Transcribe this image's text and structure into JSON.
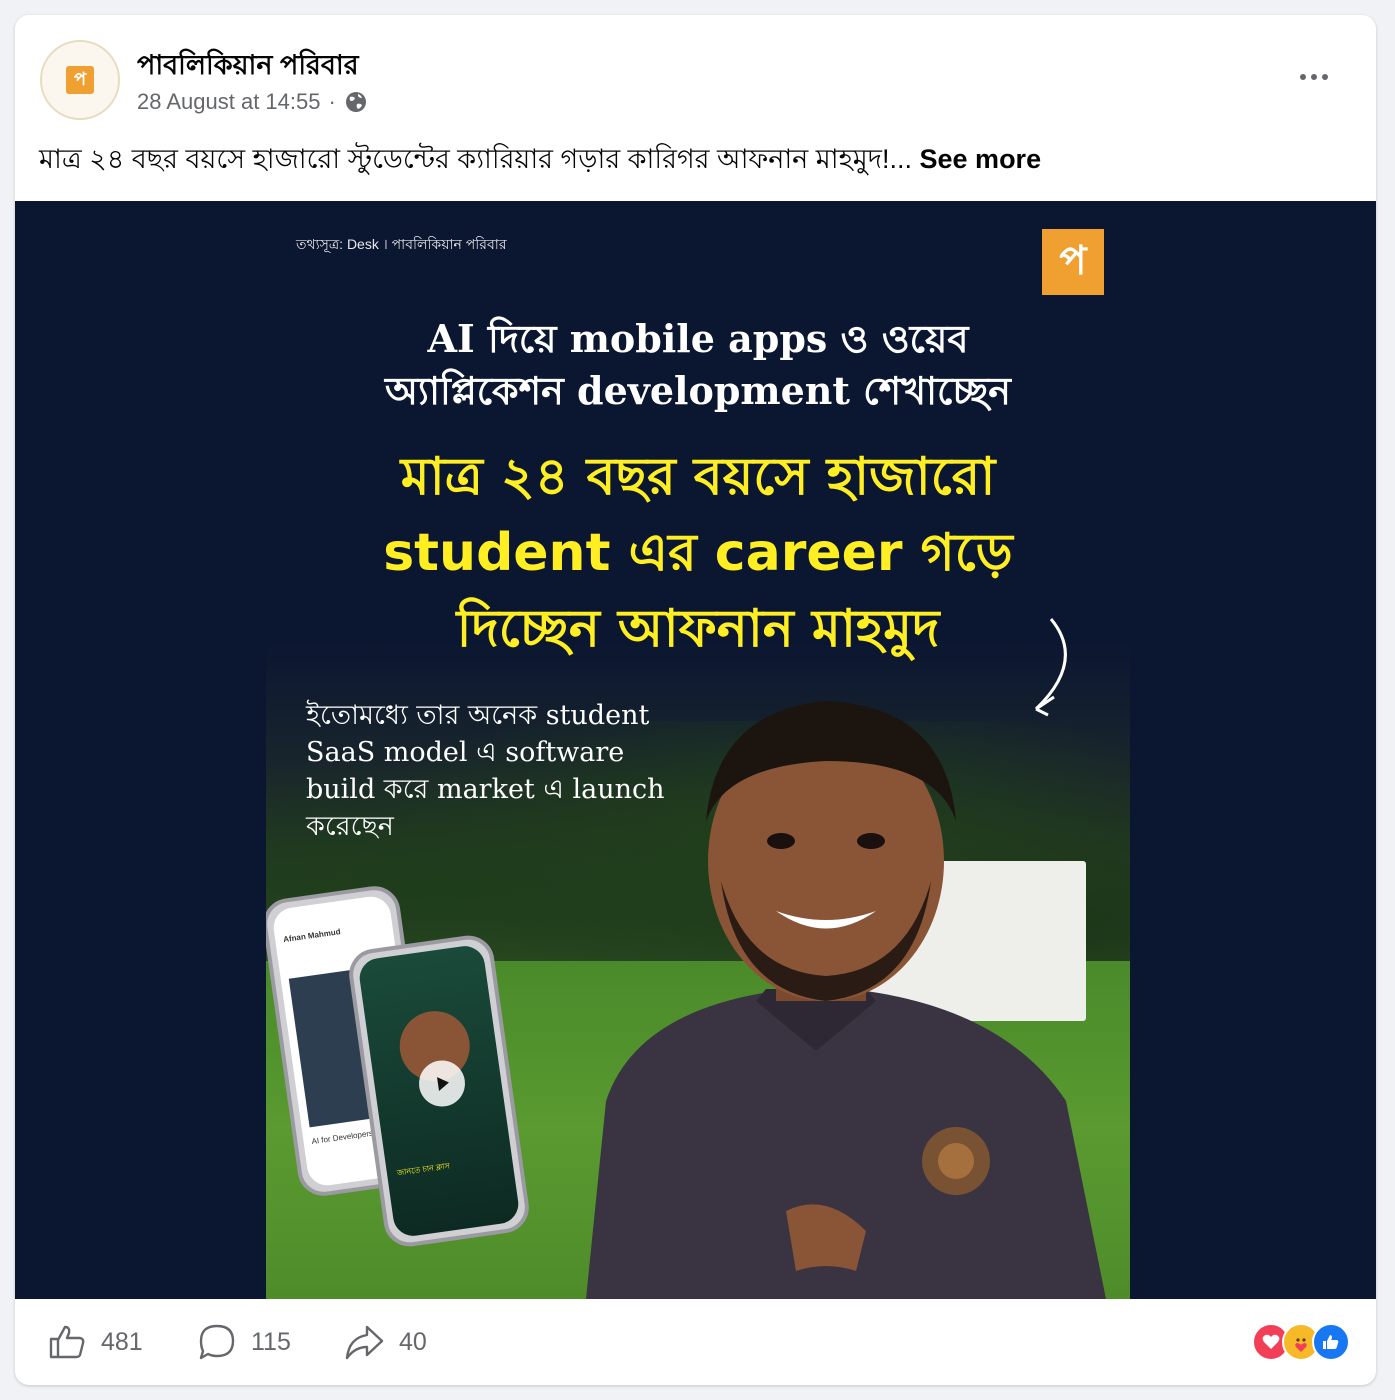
{
  "post": {
    "page_name": "পাবলিকিয়ান পরিবার",
    "timestamp": "28 August at 14:55",
    "separator": "·",
    "privacy_icon": "globe-icon",
    "caption": "মাত্র ২৪ বছর বয়সে হাজারো স্টুডেন্টের ক্যারিয়ার গড়ার কারিগর আফনান মাহমুদ!...",
    "see_more": "See more"
  },
  "image": {
    "source_text": "তথ্যসূত্র: Desk । পাবলিকিয়ান পরিবার",
    "headline_1": [
      "AI দিয়ে mobile apps ও ওয়েব",
      "অ্যাপ্লিকেশন development শেখাচ্ছেন"
    ],
    "headline_2": [
      "মাত্র ২৪ বছর বয়সে হাজারো",
      "student এর career গড়ে",
      "দিচ্ছেন আফনান মাহমুদ"
    ],
    "sub_text": [
      "ইতোমধ্যে তার অনেক student",
      "SaaS model এ software",
      "build করে market এ launch",
      "করেছেন"
    ],
    "phone_texts": {
      "profile_name": "Afnan Mahmud",
      "card_title": "AI for Developers",
      "overlay": "জানতে চান ক্লাস"
    },
    "brand_color": "#f0a030",
    "headline_color": "#ffef22",
    "background_color": "#0b1631"
  },
  "footer": {
    "likes": "481",
    "comments": "115",
    "shares": "40",
    "reactions": [
      "love-icon",
      "care-icon",
      "like-icon"
    ]
  }
}
